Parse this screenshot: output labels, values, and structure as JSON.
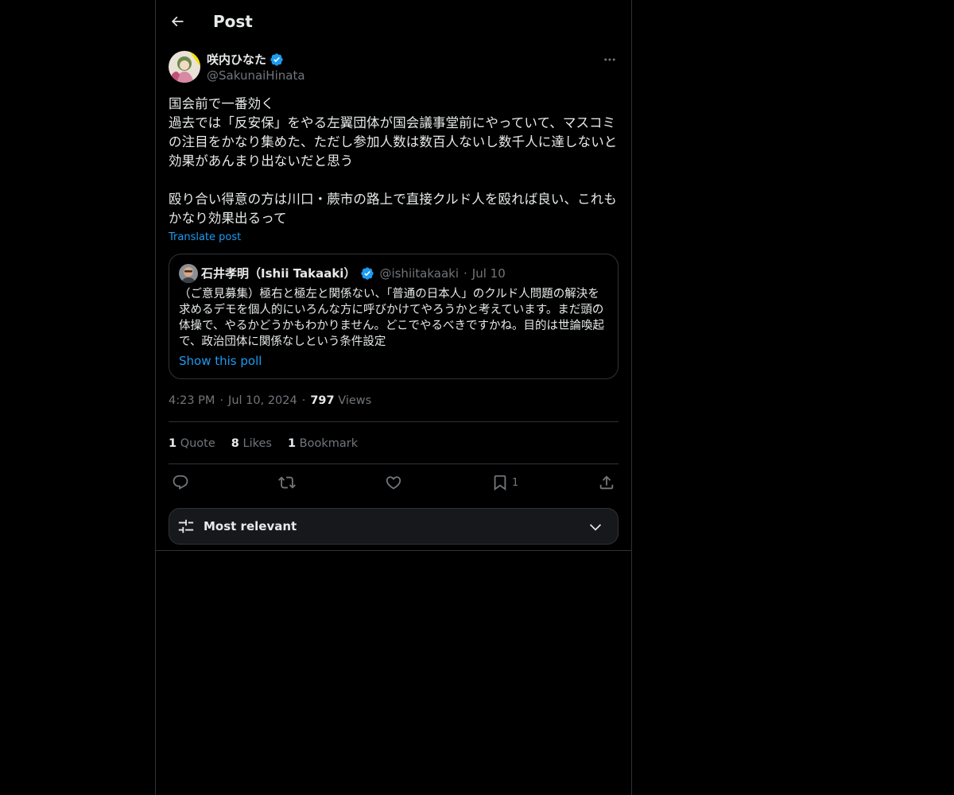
{
  "header": {
    "title": "Post"
  },
  "post": {
    "author": {
      "name": "咲内ひなた",
      "handle": "@SakunaiHinata",
      "verified": true
    },
    "text": "国会前で一番効く\n過去では「反安保」をやる左翼団体が国会議事堂前にやっていて、マスコミの注目をかなり集めた、ただし参加人数は数百人ないし数千人に達しないと効果があんまり出ないだと思う\n\n殴り合い得意の方は川口・蕨市の路上で直接クルド人を殴れば良い、これもかなり効果出るって",
    "translate_label": "Translate post",
    "quote": {
      "name": "石井孝明（Ishii Takaaki）",
      "handle": "@ishiitakaaki",
      "date": "Jul 10",
      "text": "（ご意見募集）極右と極左と関係ない、「普通の日本人」のクルド人問題の解決を求めるデモを個人的にいろんな方に呼びかけてやろうかと考えています。まだ頭の体操で、やるかどうかもわかりません。どこでやるべきですかね。目的は世論喚起で、政治団体に関係なしという条件設定",
      "show_poll_label": "Show this poll"
    },
    "meta": {
      "time": "4:23 PM",
      "date": "Jul 10, 2024",
      "views_count": "797",
      "views_label": "Views"
    },
    "stats": {
      "quotes_count": "1",
      "quotes_label": "Quote",
      "likes_count": "8",
      "likes_label": "Likes",
      "bookmarks_count": "1",
      "bookmarks_label": "Bookmark"
    },
    "actions": {
      "bookmark_count": "1"
    }
  },
  "replies_sort": {
    "label": "Most relevant"
  },
  "colors": {
    "background": "#000000",
    "text": "#e7e9ea",
    "muted": "#71767b",
    "accent": "#1d9bf0",
    "border": "#2f3336"
  }
}
